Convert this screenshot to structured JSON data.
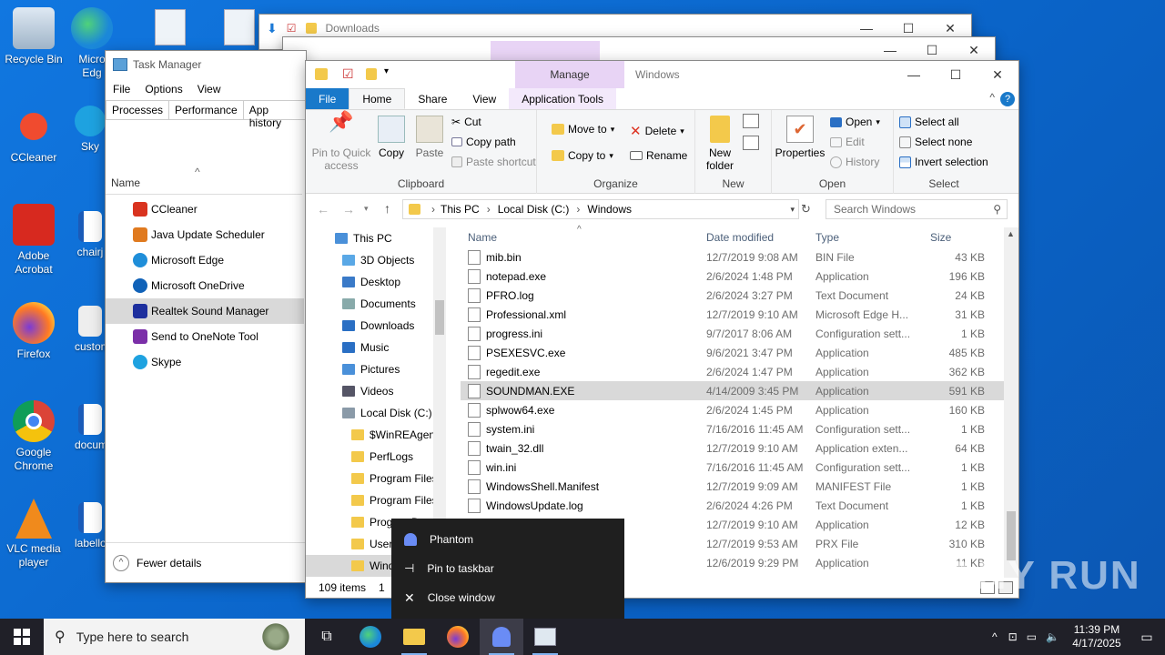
{
  "desktop_icons": [
    {
      "label": "Recycle Bin",
      "icon": "recycle-bin-icon"
    },
    {
      "label": "Micro Edg",
      "icon": "edge-icon"
    },
    {
      "label": "CCleaner",
      "icon": "ccleaner-icon"
    },
    {
      "label": "Sky",
      "icon": "skype-icon"
    },
    {
      "label": "Adobe Acrobat",
      "icon": "acrobat-icon"
    },
    {
      "label": "chairj",
      "icon": "word-doc-icon"
    },
    {
      "label": "Firefox",
      "icon": "firefox-icon"
    },
    {
      "label": "custom",
      "icon": "file-icon"
    },
    {
      "label": "Google Chrome",
      "icon": "chrome-icon"
    },
    {
      "label": "docum",
      "icon": "word-doc-icon"
    },
    {
      "label": "VLC media player",
      "icon": "vlc-icon"
    },
    {
      "label": "labello",
      "icon": "word-doc-icon"
    }
  ],
  "bg_windows": {
    "downloads_title": "Downloads"
  },
  "task_manager": {
    "title": "Task Manager",
    "menu": [
      "File",
      "Options",
      "View"
    ],
    "tabs": [
      "Processes",
      "Performance",
      "App history"
    ],
    "col_name": "Name",
    "items": [
      {
        "label": "CCleaner",
        "color": "#d9331f"
      },
      {
        "label": "Java Update Scheduler",
        "color": "#e07a1f"
      },
      {
        "label": "Microsoft Edge",
        "color": "#1f8ed9"
      },
      {
        "label": "Microsoft OneDrive",
        "color": "#1062b8"
      },
      {
        "label": "Realtek Sound Manager",
        "color": "#1d2f9e"
      },
      {
        "label": "Send to OneNote Tool",
        "color": "#7b2fa8"
      },
      {
        "label": "Skype",
        "color": "#1ea2e0"
      }
    ],
    "selected_index": 4,
    "fewer_details": "Fewer details"
  },
  "explorer": {
    "context_tab": "Manage",
    "title": "Windows",
    "ribbon_tabs": [
      "File",
      "Home",
      "Share",
      "View",
      "Application Tools"
    ],
    "clipboard": {
      "pin": "Pin to Quick access",
      "copy": "Copy",
      "paste": "Paste",
      "cut": "Cut",
      "copy_path": "Copy path",
      "paste_shortcut": "Paste shortcut",
      "label": "Clipboard"
    },
    "organize": {
      "move_to": "Move to",
      "copy_to": "Copy to",
      "delete": "Delete",
      "rename": "Rename",
      "label": "Organize"
    },
    "new": {
      "new_folder": "New folder",
      "label": "New"
    },
    "open": {
      "properties": "Properties",
      "open": "Open",
      "edit": "Edit",
      "history": "History",
      "label": "Open"
    },
    "select": {
      "all": "Select all",
      "none": "Select none",
      "invert": "Invert selection",
      "label": "Select"
    },
    "breadcrumb": [
      "This PC",
      "Local Disk (C:)",
      "Windows"
    ],
    "search_placeholder": "Search Windows",
    "nav_items": [
      {
        "label": "This PC",
        "indent": 0,
        "kind": "pc"
      },
      {
        "label": "3D Objects",
        "indent": 1,
        "kind": "3d"
      },
      {
        "label": "Desktop",
        "indent": 1,
        "kind": "desktop"
      },
      {
        "label": "Documents",
        "indent": 1,
        "kind": "documents"
      },
      {
        "label": "Downloads",
        "indent": 1,
        "kind": "downloads"
      },
      {
        "label": "Music",
        "indent": 1,
        "kind": "music"
      },
      {
        "label": "Pictures",
        "indent": 1,
        "kind": "pictures"
      },
      {
        "label": "Videos",
        "indent": 1,
        "kind": "videos"
      },
      {
        "label": "Local Disk (C:)",
        "indent": 1,
        "kind": "disk"
      },
      {
        "label": "$WinREAgent",
        "indent": 2,
        "kind": "folder"
      },
      {
        "label": "PerfLogs",
        "indent": 2,
        "kind": "folder"
      },
      {
        "label": "Program Files",
        "indent": 2,
        "kind": "folder"
      },
      {
        "label": "Program Files",
        "indent": 2,
        "kind": "folder"
      },
      {
        "label": "ProgramData",
        "indent": 2,
        "kind": "folder"
      },
      {
        "label": "Users",
        "indent": 2,
        "kind": "folder"
      },
      {
        "label": "Windows",
        "indent": 2,
        "kind": "folder"
      }
    ],
    "columns": [
      "Name",
      "Date modified",
      "Type",
      "Size"
    ],
    "files": [
      {
        "name": "mib.bin",
        "date": "12/7/2019 9:08 AM",
        "type": "BIN File",
        "size": "43 KB"
      },
      {
        "name": "notepad.exe",
        "date": "2/6/2024 1:48 PM",
        "type": "Application",
        "size": "196 KB"
      },
      {
        "name": "PFRO.log",
        "date": "2/6/2024 3:27 PM",
        "type": "Text Document",
        "size": "24 KB"
      },
      {
        "name": "Professional.xml",
        "date": "12/7/2019 9:10 AM",
        "type": "Microsoft Edge H...",
        "size": "31 KB"
      },
      {
        "name": "progress.ini",
        "date": "9/7/2017 8:06 AM",
        "type": "Configuration sett...",
        "size": "1 KB"
      },
      {
        "name": "PSEXESVC.exe",
        "date": "9/6/2021 3:47 PM",
        "type": "Application",
        "size": "485 KB"
      },
      {
        "name": "regedit.exe",
        "date": "2/6/2024 1:47 PM",
        "type": "Application",
        "size": "362 KB"
      },
      {
        "name": "SOUNDMAN.EXE",
        "date": "4/14/2009 3:45 PM",
        "type": "Application",
        "size": "591 KB"
      },
      {
        "name": "splwow64.exe",
        "date": "2/6/2024 1:45 PM",
        "type": "Application",
        "size": "160 KB"
      },
      {
        "name": "system.ini",
        "date": "7/16/2016 11:45 AM",
        "type": "Configuration sett...",
        "size": "1 KB"
      },
      {
        "name": "twain_32.dll",
        "date": "12/7/2019 9:10 AM",
        "type": "Application exten...",
        "size": "64 KB"
      },
      {
        "name": "win.ini",
        "date": "7/16/2016 11:45 AM",
        "type": "Configuration sett...",
        "size": "1 KB"
      },
      {
        "name": "WindowsShell.Manifest",
        "date": "12/7/2019 9:09 AM",
        "type": "MANIFEST File",
        "size": "1 KB"
      },
      {
        "name": "WindowsUpdate.log",
        "date": "2/6/2024 4:26 PM",
        "type": "Text Document",
        "size": "1 KB"
      },
      {
        "name": "",
        "date": "12/7/2019 9:10 AM",
        "type": "Application",
        "size": "12 KB"
      },
      {
        "name": "",
        "date": "12/7/2019 9:53 AM",
        "type": "PRX File",
        "size": "310 KB"
      },
      {
        "name": "",
        "date": "12/6/2019 9:29 PM",
        "type": "Application",
        "size": "11 KB"
      }
    ],
    "selected_file_index": 7,
    "status_items": "109 items",
    "status_selected": "1"
  },
  "jump_list": {
    "app_name": "Phantom",
    "pin": "Pin to taskbar",
    "close": "Close window"
  },
  "taskbar": {
    "search_placeholder": "Type here to search",
    "time": "11:39 PM",
    "date": "4/17/2025"
  },
  "watermark": "ANY RUN"
}
